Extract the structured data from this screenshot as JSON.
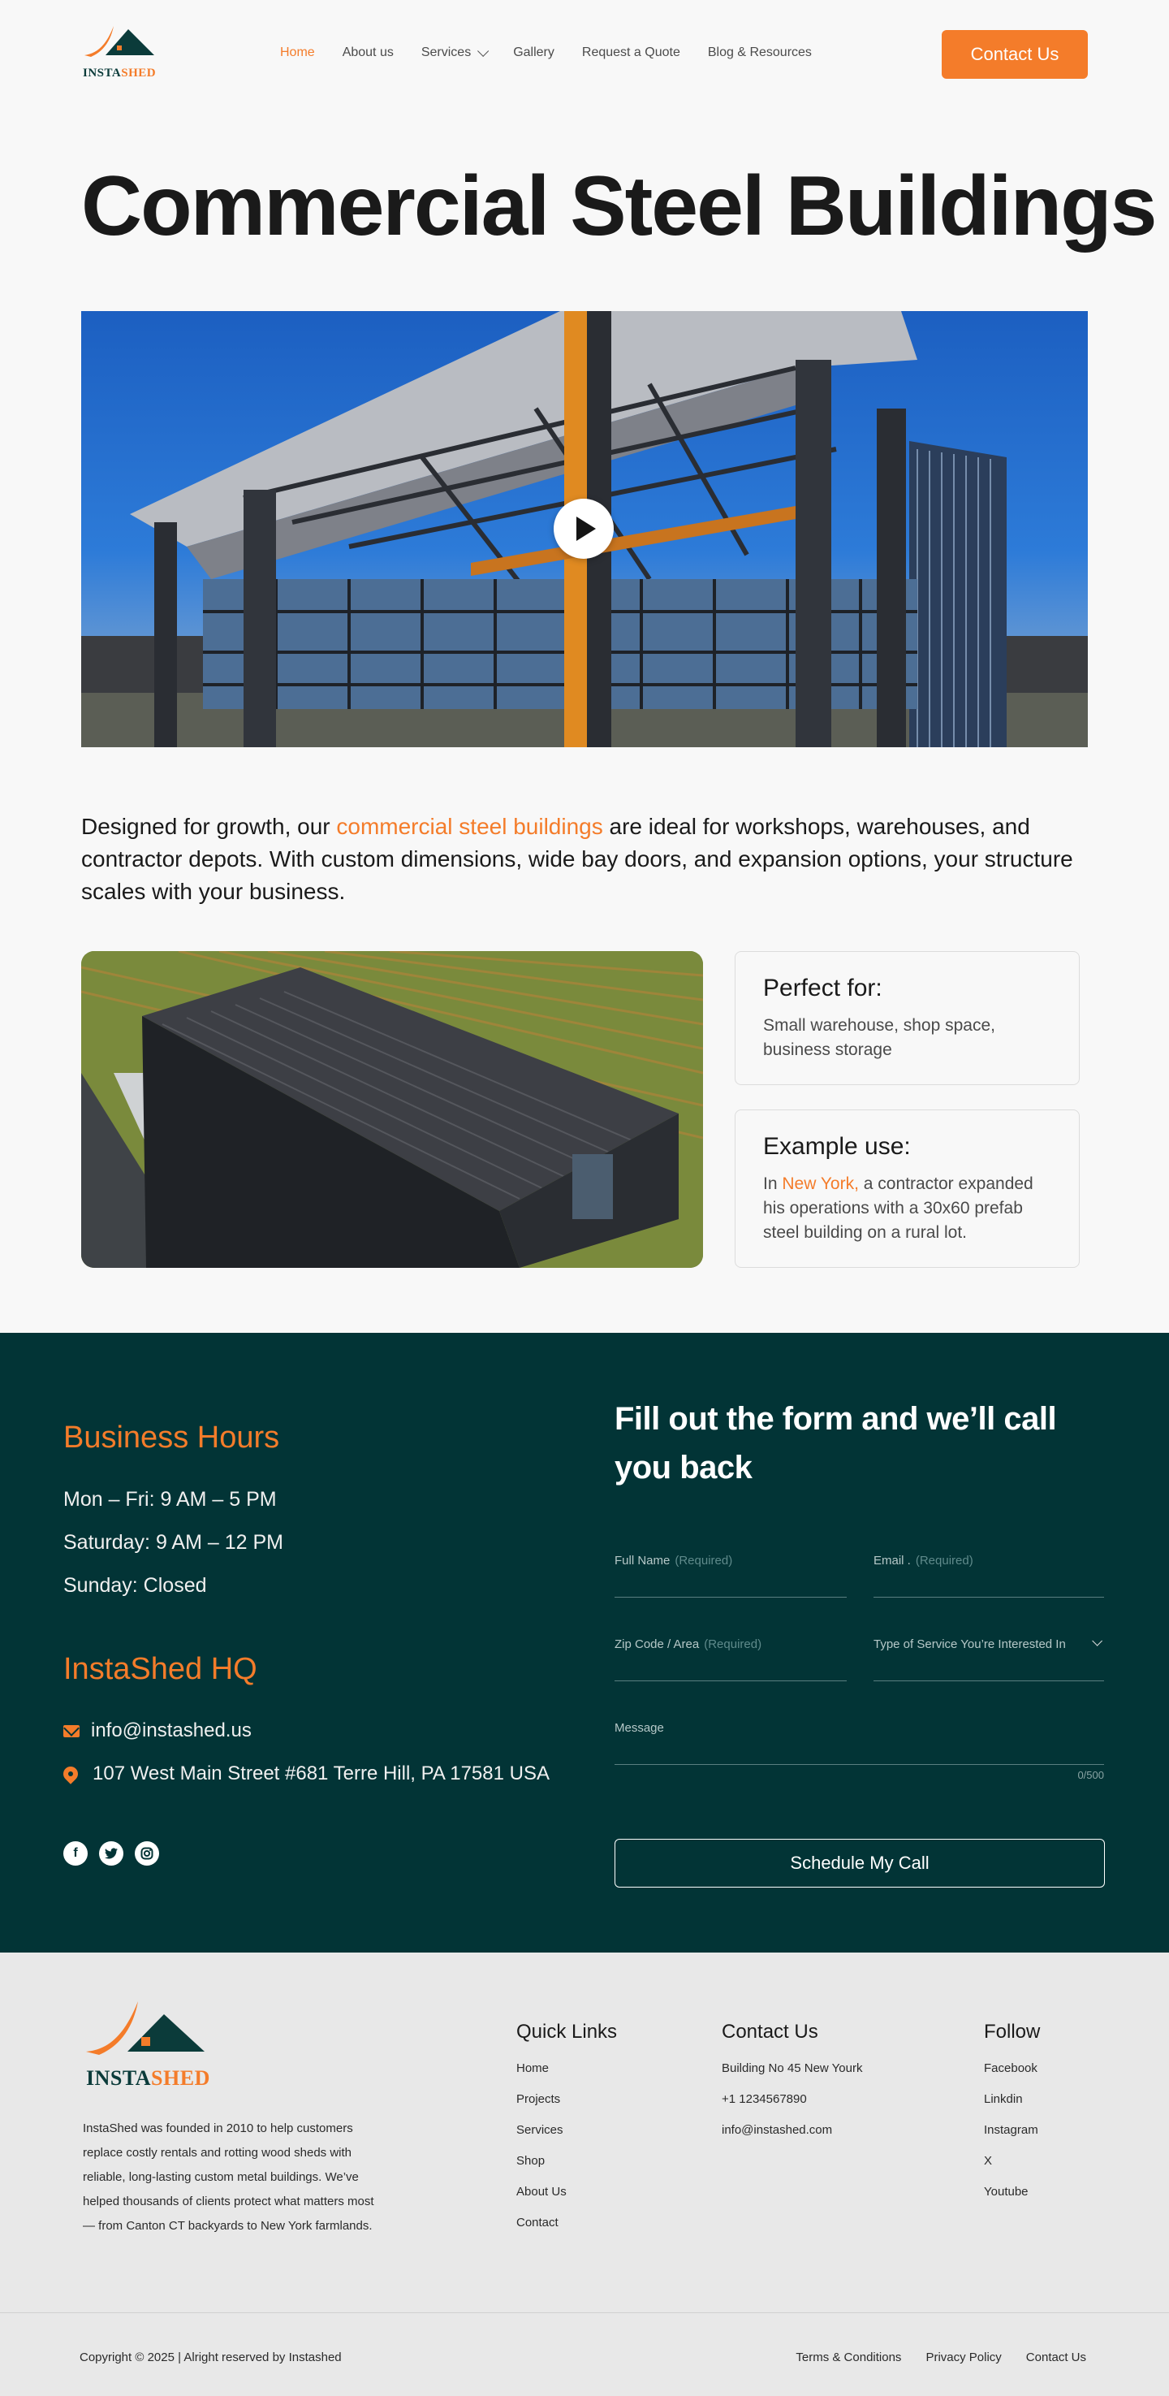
{
  "brand": {
    "logo_part1": "INSTA",
    "logo_part2": "SHED"
  },
  "nav": {
    "items": [
      {
        "label": "Home"
      },
      {
        "label": "About us"
      },
      {
        "label": "Services"
      },
      {
        "label": "Gallery"
      },
      {
        "label": "Request a Quote"
      },
      {
        "label": "Blog & Resources"
      }
    ],
    "active": "Home",
    "contact_button": "Contact Us"
  },
  "page": {
    "title": "Commercial Steel Buildings",
    "intro_before": "Designed for growth, our ",
    "intro_link": "commercial steel buildings",
    "intro_after": " are ideal for workshops, warehouses, and contractor depots. With custom dimensions, wide bay doors, and expansion options, your structure scales with your business."
  },
  "cards": {
    "perfect": {
      "title": "Perfect for:",
      "text": "Small warehouse, shop space, business storage"
    },
    "example": {
      "title": "Example use:",
      "text_before": "In ",
      "link": "New York,",
      "text_after": " a contractor expanded his operations with a 30x60 prefab steel building on a rural lot."
    }
  },
  "hours": {
    "title": "Business Hours",
    "lines": [
      "Mon – Fri: 9 AM – 5 PM",
      "Saturday: 9 AM – 12 PM",
      "Sunday: Closed"
    ]
  },
  "hq": {
    "title": "InstaShed HQ",
    "email": "info@instashed.us",
    "address": "107 West Main Street #681 Terre Hill, PA 17581 USA"
  },
  "form": {
    "title": "Fill out the form and we’ll call you back",
    "full_name": "Full Name",
    "email": "Email .",
    "zip": "Zip Code / Area",
    "service_type": "Type of Service You’re Interested In",
    "message": "Message",
    "required": "(Required)",
    "counter": "0/500",
    "submit": "Schedule My Call"
  },
  "footer": {
    "logo_part1": "INSTA",
    "logo_part2": "SHED",
    "about": "InstaShed was founded in 2010 to help customers replace costly rentals and rotting wood sheds with reliable, long-lasting custom metal buildings. We’ve helped thousands of clients protect what matters most — from Canton CT backyards to New York farmlands.",
    "quick_links": {
      "title": "Quick Links",
      "items": [
        "Home",
        "Projects",
        "Services",
        "Shop",
        "About Us",
        "Contact"
      ]
    },
    "contact": {
      "title": "Contact Us",
      "items": [
        "Building No 45 New Yourk",
        "+1 1234567890",
        "info@instashed.com"
      ]
    },
    "follow": {
      "title": "Follow",
      "items": [
        "Facebook",
        "Linkdin",
        "Instagram",
        "X",
        "Youtube"
      ]
    },
    "copyright": "Copyright © 2025 | Alright reserved by  Instashed",
    "legal": [
      "Terms & Conditions",
      "Privacy Policy",
      "Contact Us"
    ]
  },
  "colors": {
    "accent": "#f47c2a",
    "dark": "#023436",
    "footer_bg": "#e8e8e8"
  }
}
